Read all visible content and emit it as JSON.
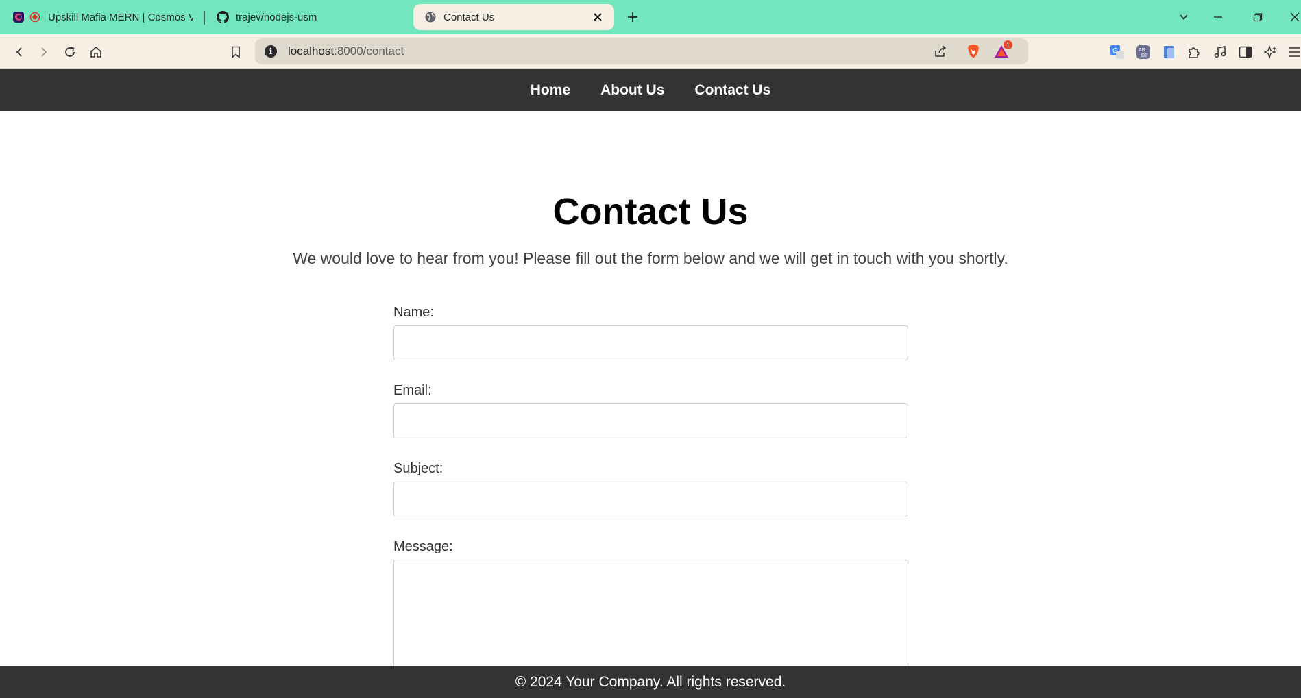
{
  "browser": {
    "tabs": [
      {
        "title": "Upskill Mafia MERN | Cosmos Vi"
      },
      {
        "title": "trajev/nodejs-usm"
      },
      {
        "title": "Contact Us"
      }
    ],
    "url_host": "localhost",
    "url_path": ":8000/contact",
    "notification_count": "1"
  },
  "nav": {
    "items": [
      {
        "label": "Home"
      },
      {
        "label": "About Us"
      },
      {
        "label": "Contact Us"
      }
    ]
  },
  "main": {
    "title": "Contact Us",
    "intro": "We would love to hear from you! Please fill out the form below and we will get in touch with you shortly."
  },
  "form": {
    "name_label": "Name:",
    "name_value": "",
    "email_label": "Email:",
    "email_value": "",
    "subject_label": "Subject:",
    "subject_value": "",
    "message_label": "Message:",
    "message_value": ""
  },
  "footer": {
    "text": "© 2024 Your Company. All rights reserved."
  },
  "colors": {
    "tabstrip": "#74e6bd",
    "toolbar": "#f7efe4",
    "nav_bg": "#333333",
    "footer_bg": "#333333"
  }
}
